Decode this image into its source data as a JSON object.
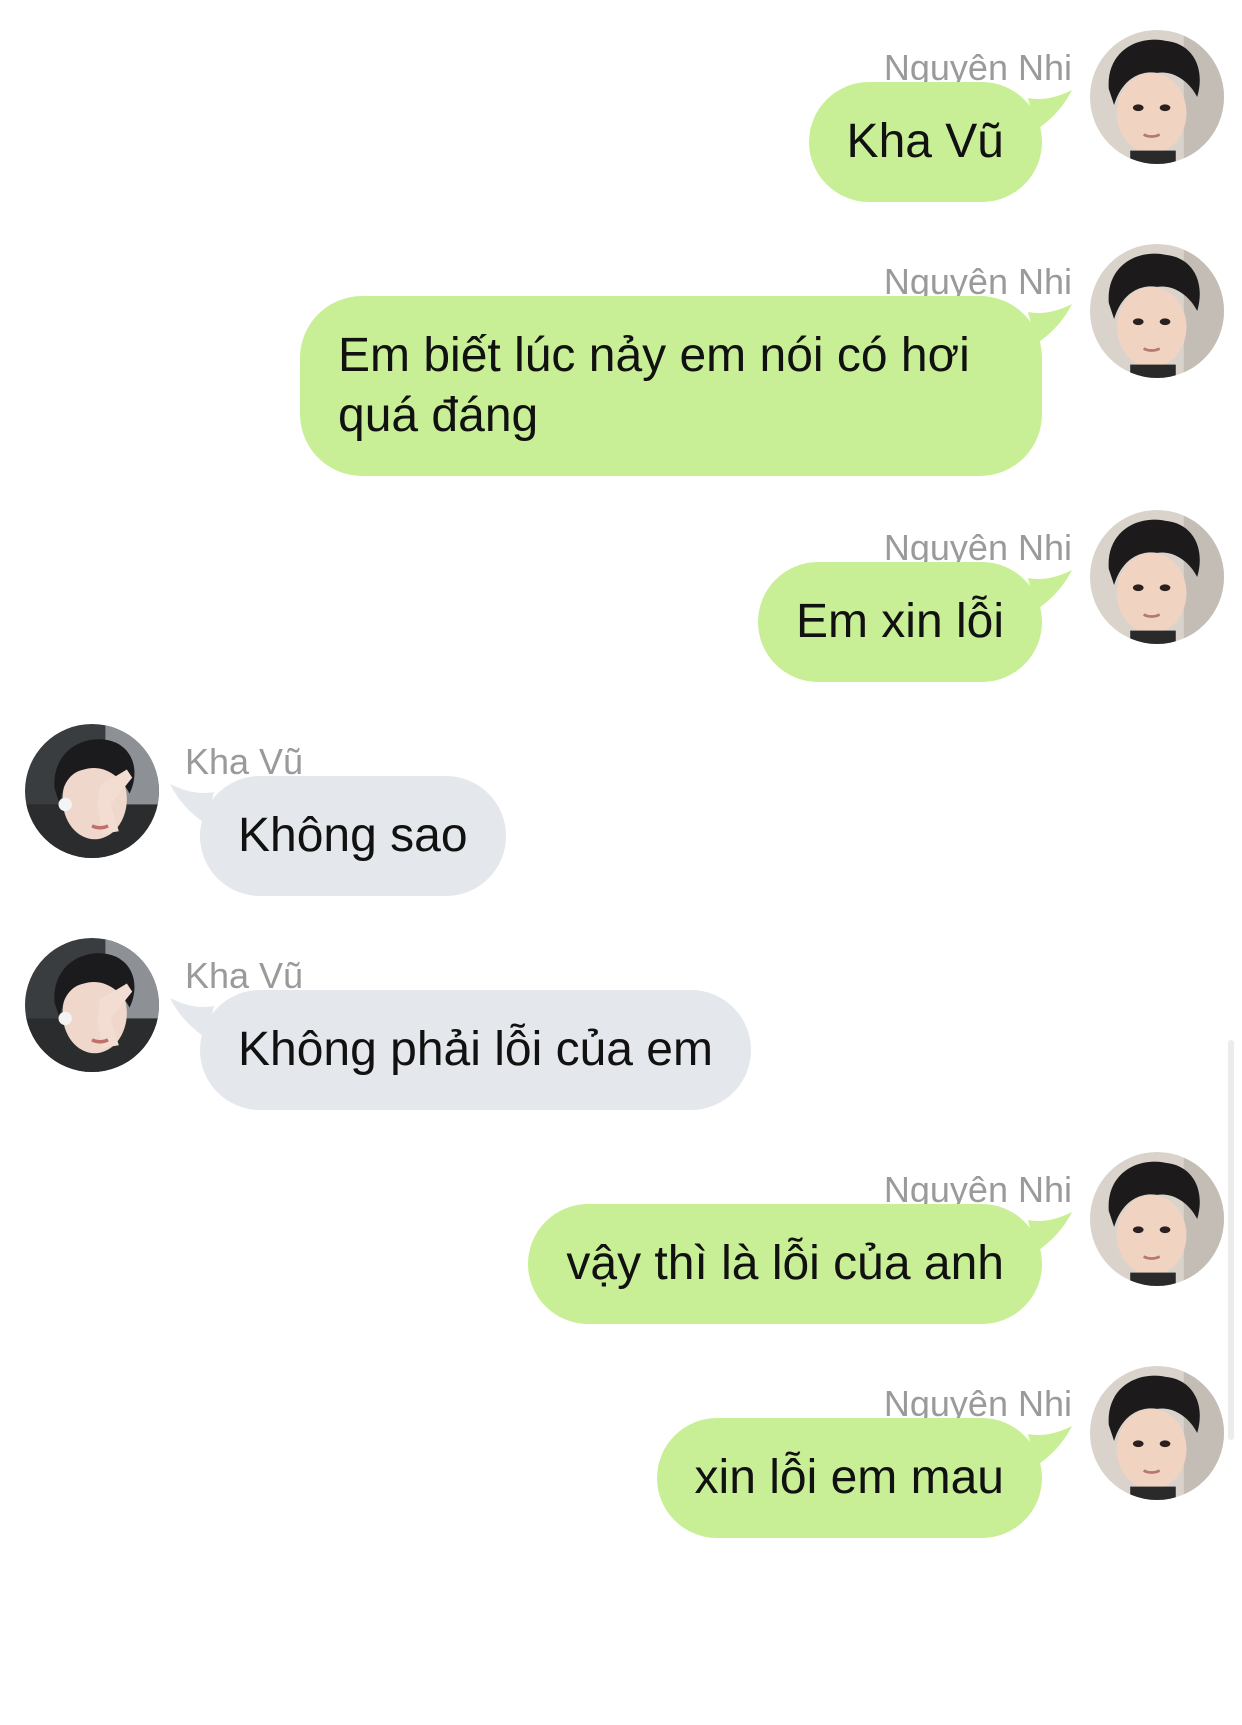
{
  "chat": {
    "messages": [
      {
        "side": "right",
        "sender": "Nguyên Nhi",
        "text": "Kha Vũ"
      },
      {
        "side": "right",
        "sender": "Nguyên Nhi",
        "text": "Em biết lúc nảy em nói có hơi quá đáng"
      },
      {
        "side": "right",
        "sender": "Nguyên Nhi",
        "text": "Em xin lỗi"
      },
      {
        "side": "left",
        "sender": "Kha Vũ",
        "text": "Không sao"
      },
      {
        "side": "left",
        "sender": "Kha Vũ",
        "text": "Không phải lỗi của em"
      },
      {
        "side": "right",
        "sender": "Nguyên Nhi",
        "text": "vậy thì là lỗi của anh"
      },
      {
        "side": "right",
        "sender": "Nguyên Nhi",
        "text": "xin lỗi em mau"
      }
    ]
  },
  "colors": {
    "outgoing_bubble": "#c9ef96",
    "incoming_bubble": "#e4e7eb",
    "sender_name": "#9a9a9a"
  }
}
